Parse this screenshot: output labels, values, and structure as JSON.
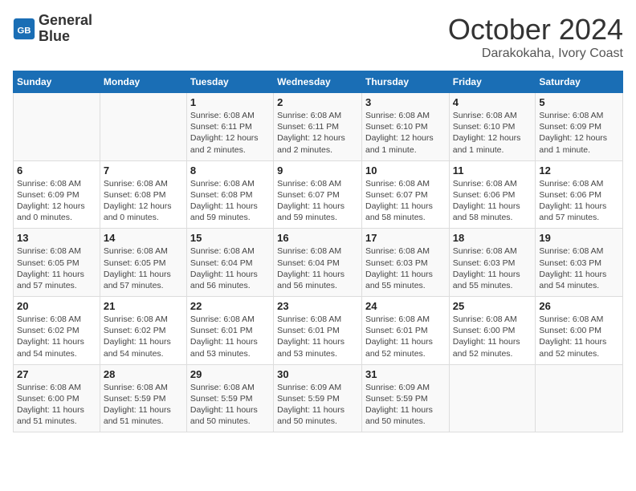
{
  "header": {
    "logo_line1": "General",
    "logo_line2": "Blue",
    "month": "October 2024",
    "location": "Darakokaha, Ivory Coast"
  },
  "weekdays": [
    "Sunday",
    "Monday",
    "Tuesday",
    "Wednesday",
    "Thursday",
    "Friday",
    "Saturday"
  ],
  "weeks": [
    [
      {
        "day": "",
        "info": ""
      },
      {
        "day": "",
        "info": ""
      },
      {
        "day": "1",
        "info": "Sunrise: 6:08 AM\nSunset: 6:11 PM\nDaylight: 12 hours and 2 minutes."
      },
      {
        "day": "2",
        "info": "Sunrise: 6:08 AM\nSunset: 6:11 PM\nDaylight: 12 hours and 2 minutes."
      },
      {
        "day": "3",
        "info": "Sunrise: 6:08 AM\nSunset: 6:10 PM\nDaylight: 12 hours and 1 minute."
      },
      {
        "day": "4",
        "info": "Sunrise: 6:08 AM\nSunset: 6:10 PM\nDaylight: 12 hours and 1 minute."
      },
      {
        "day": "5",
        "info": "Sunrise: 6:08 AM\nSunset: 6:09 PM\nDaylight: 12 hours and 1 minute."
      }
    ],
    [
      {
        "day": "6",
        "info": "Sunrise: 6:08 AM\nSunset: 6:09 PM\nDaylight: 12 hours and 0 minutes."
      },
      {
        "day": "7",
        "info": "Sunrise: 6:08 AM\nSunset: 6:08 PM\nDaylight: 12 hours and 0 minutes."
      },
      {
        "day": "8",
        "info": "Sunrise: 6:08 AM\nSunset: 6:08 PM\nDaylight: 11 hours and 59 minutes."
      },
      {
        "day": "9",
        "info": "Sunrise: 6:08 AM\nSunset: 6:07 PM\nDaylight: 11 hours and 59 minutes."
      },
      {
        "day": "10",
        "info": "Sunrise: 6:08 AM\nSunset: 6:07 PM\nDaylight: 11 hours and 58 minutes."
      },
      {
        "day": "11",
        "info": "Sunrise: 6:08 AM\nSunset: 6:06 PM\nDaylight: 11 hours and 58 minutes."
      },
      {
        "day": "12",
        "info": "Sunrise: 6:08 AM\nSunset: 6:06 PM\nDaylight: 11 hours and 57 minutes."
      }
    ],
    [
      {
        "day": "13",
        "info": "Sunrise: 6:08 AM\nSunset: 6:05 PM\nDaylight: 11 hours and 57 minutes."
      },
      {
        "day": "14",
        "info": "Sunrise: 6:08 AM\nSunset: 6:05 PM\nDaylight: 11 hours and 57 minutes."
      },
      {
        "day": "15",
        "info": "Sunrise: 6:08 AM\nSunset: 6:04 PM\nDaylight: 11 hours and 56 minutes."
      },
      {
        "day": "16",
        "info": "Sunrise: 6:08 AM\nSunset: 6:04 PM\nDaylight: 11 hours and 56 minutes."
      },
      {
        "day": "17",
        "info": "Sunrise: 6:08 AM\nSunset: 6:03 PM\nDaylight: 11 hours and 55 minutes."
      },
      {
        "day": "18",
        "info": "Sunrise: 6:08 AM\nSunset: 6:03 PM\nDaylight: 11 hours and 55 minutes."
      },
      {
        "day": "19",
        "info": "Sunrise: 6:08 AM\nSunset: 6:03 PM\nDaylight: 11 hours and 54 minutes."
      }
    ],
    [
      {
        "day": "20",
        "info": "Sunrise: 6:08 AM\nSunset: 6:02 PM\nDaylight: 11 hours and 54 minutes."
      },
      {
        "day": "21",
        "info": "Sunrise: 6:08 AM\nSunset: 6:02 PM\nDaylight: 11 hours and 54 minutes."
      },
      {
        "day": "22",
        "info": "Sunrise: 6:08 AM\nSunset: 6:01 PM\nDaylight: 11 hours and 53 minutes."
      },
      {
        "day": "23",
        "info": "Sunrise: 6:08 AM\nSunset: 6:01 PM\nDaylight: 11 hours and 53 minutes."
      },
      {
        "day": "24",
        "info": "Sunrise: 6:08 AM\nSunset: 6:01 PM\nDaylight: 11 hours and 52 minutes."
      },
      {
        "day": "25",
        "info": "Sunrise: 6:08 AM\nSunset: 6:00 PM\nDaylight: 11 hours and 52 minutes."
      },
      {
        "day": "26",
        "info": "Sunrise: 6:08 AM\nSunset: 6:00 PM\nDaylight: 11 hours and 52 minutes."
      }
    ],
    [
      {
        "day": "27",
        "info": "Sunrise: 6:08 AM\nSunset: 6:00 PM\nDaylight: 11 hours and 51 minutes."
      },
      {
        "day": "28",
        "info": "Sunrise: 6:08 AM\nSunset: 5:59 PM\nDaylight: 11 hours and 51 minutes."
      },
      {
        "day": "29",
        "info": "Sunrise: 6:08 AM\nSunset: 5:59 PM\nDaylight: 11 hours and 50 minutes."
      },
      {
        "day": "30",
        "info": "Sunrise: 6:09 AM\nSunset: 5:59 PM\nDaylight: 11 hours and 50 minutes."
      },
      {
        "day": "31",
        "info": "Sunrise: 6:09 AM\nSunset: 5:59 PM\nDaylight: 11 hours and 50 minutes."
      },
      {
        "day": "",
        "info": ""
      },
      {
        "day": "",
        "info": ""
      }
    ]
  ]
}
